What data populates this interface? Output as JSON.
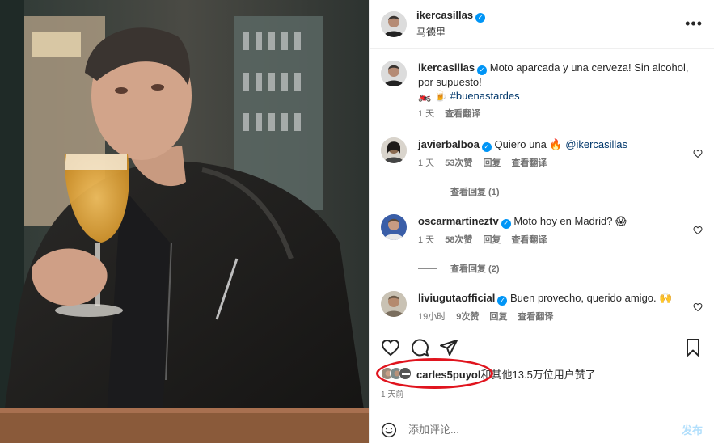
{
  "post": {
    "author": "ikercasillas",
    "location": "马德里",
    "caption": {
      "author": "ikercasillas",
      "text": "Moto aparcada y una cerveza! Sin alcohol, por supuesto!",
      "emoji_line": "🏍️ 🍺",
      "hashtag": "#buenastardes",
      "time": "1 天",
      "translate": "查看翻译"
    },
    "comments": [
      {
        "user": "javierbalboa",
        "verified": true,
        "text": "Quiero una 🔥",
        "mention": "@ikercasillas",
        "time": "1 天",
        "likes": "53次赞",
        "reply": "回复",
        "translate": "查看翻译",
        "view_replies": "查看回复 (1)"
      },
      {
        "user": "oscarmartineztv",
        "verified": true,
        "text": "Moto hoy en Madrid? 😱",
        "mention": "",
        "time": "1 天",
        "likes": "58次赞",
        "reply": "回复",
        "translate": "查看翻译",
        "view_replies": "查看回复 (2)"
      },
      {
        "user": "liviugutaofficial",
        "verified": true,
        "text": "Buen provecho, querido amigo. 🙌",
        "mention": "",
        "time": "19小时",
        "likes": "9次赞",
        "reply": "回复",
        "translate": "查看翻译",
        "view_replies": ""
      }
    ],
    "likes": {
      "liker": "carles5puyol",
      "rest": "和其他13.5万位用户赞了"
    },
    "date": "1 天前",
    "add_comment": {
      "placeholder": "添加评论...",
      "post_label": "发布"
    }
  },
  "icons": {
    "verified": "verified-badge",
    "more": "more-horizontal-icon",
    "like": "heart-icon",
    "comment": "comment-icon",
    "share": "send-icon",
    "save": "bookmark-icon",
    "emoji": "emoji-icon"
  },
  "colors": {
    "accent": "#0095f6",
    "highlight": "#e0141e",
    "post_disabled": "#b2dffc"
  }
}
